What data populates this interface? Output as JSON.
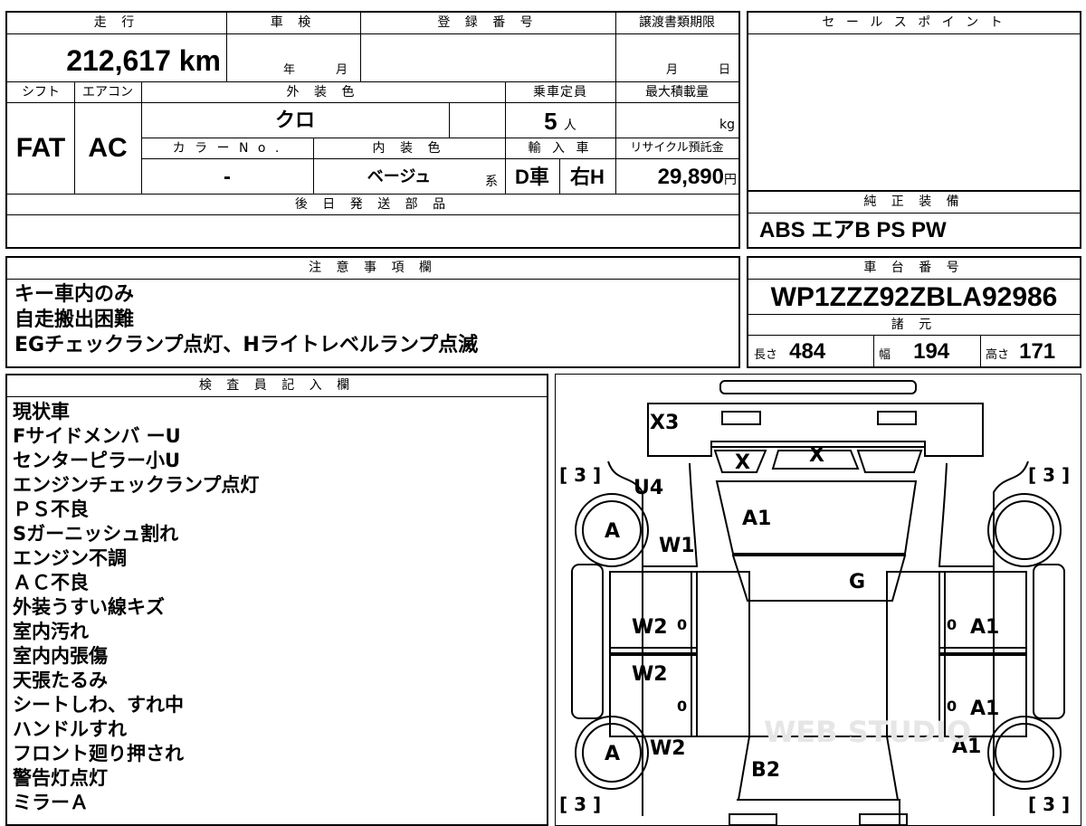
{
  "vehicle": {
    "headers": {
      "mileage": "走 行",
      "inspection": "車 検",
      "registration": "登 録 番 号",
      "transfer_deadline": "譲渡書類期限",
      "shift": "シフト",
      "aircon": "エアコン",
      "exterior_color": "外 装 色",
      "capacity": "乗車定員",
      "max_load": "最大積載量",
      "color_no": "カ ラ ー N o .",
      "interior_color": "内 装 色",
      "import": "輸 入 車",
      "recycle": "リサイクル預託金",
      "later_parts": "後 日 発 送 部 品",
      "sales_point": "セ ー ル ス ポ イ ン ト",
      "genuine_equipment": "純 正 装 備"
    },
    "mileage": "212,617",
    "mileage_unit": "km",
    "inspection_year_unit": "年",
    "inspection_month_unit": "月",
    "transfer_month_unit": "月",
    "transfer_day_unit": "日",
    "shift": "FAT",
    "aircon": "AC",
    "exterior_color": "クロ",
    "capacity": "5",
    "capacity_unit": "人",
    "max_load_unit": "kg",
    "color_no": "-",
    "interior_color": "ベージュ",
    "interior_suffix": "系",
    "import_type": "D車",
    "handle": "右H",
    "recycle_amount": "29,890",
    "recycle_unit": "円",
    "genuine_equipment": "ABS エアB PS PW"
  },
  "notes": {
    "header": "注 意 事 項 欄",
    "lines": [
      "キー車内のみ",
      "自走搬出困難",
      "EGチェックランプ点灯、Hライトレベルランプ点滅"
    ]
  },
  "chassis": {
    "header": "車 台 番 号",
    "number": "WP1ZZZ92ZBLA92986",
    "specs_header": "諸 元",
    "length_label": "長さ",
    "length": "484",
    "width_label": "幅",
    "width": "194",
    "height_label": "高さ",
    "height": "171"
  },
  "inspector": {
    "header": "検 査 員 記 入 欄",
    "lines": [
      "現状車",
      "Fサイドメンバ ーU",
      "センターピラー小U",
      "エンジンチェックランプ点灯",
      "ＰＳ不良",
      "Sガーニッシュ割れ",
      "エンジン不調",
      "ＡＣ不良",
      "外装うすい線キズ",
      "室内汚れ",
      "室内内張傷",
      "天張たるみ",
      "シートしわ、すれ中",
      "ハンドルすれ",
      "フロント廻り押され",
      "警告灯点灯",
      "ミラーＡ"
    ]
  },
  "diagram": {
    "tire_bracket": "[ 3 ]",
    "marks": {
      "x3": "X3",
      "x_left": "X",
      "x_right": "X",
      "u4": "U4",
      "a1_hood": "A1",
      "w1": "W1",
      "g": "G",
      "w2_front_door": "W2",
      "w2_rear_door": "W2",
      "w2_rear": "W2",
      "a1_front_door_r": "A1",
      "a1_rear_door_r": "A1",
      "a1_rear_r": "A1",
      "b2": "B2",
      "a_front_wheel": "A",
      "a_rear_wheel": "A",
      "zero": "0"
    },
    "watermark": "WEB STUDIO"
  }
}
